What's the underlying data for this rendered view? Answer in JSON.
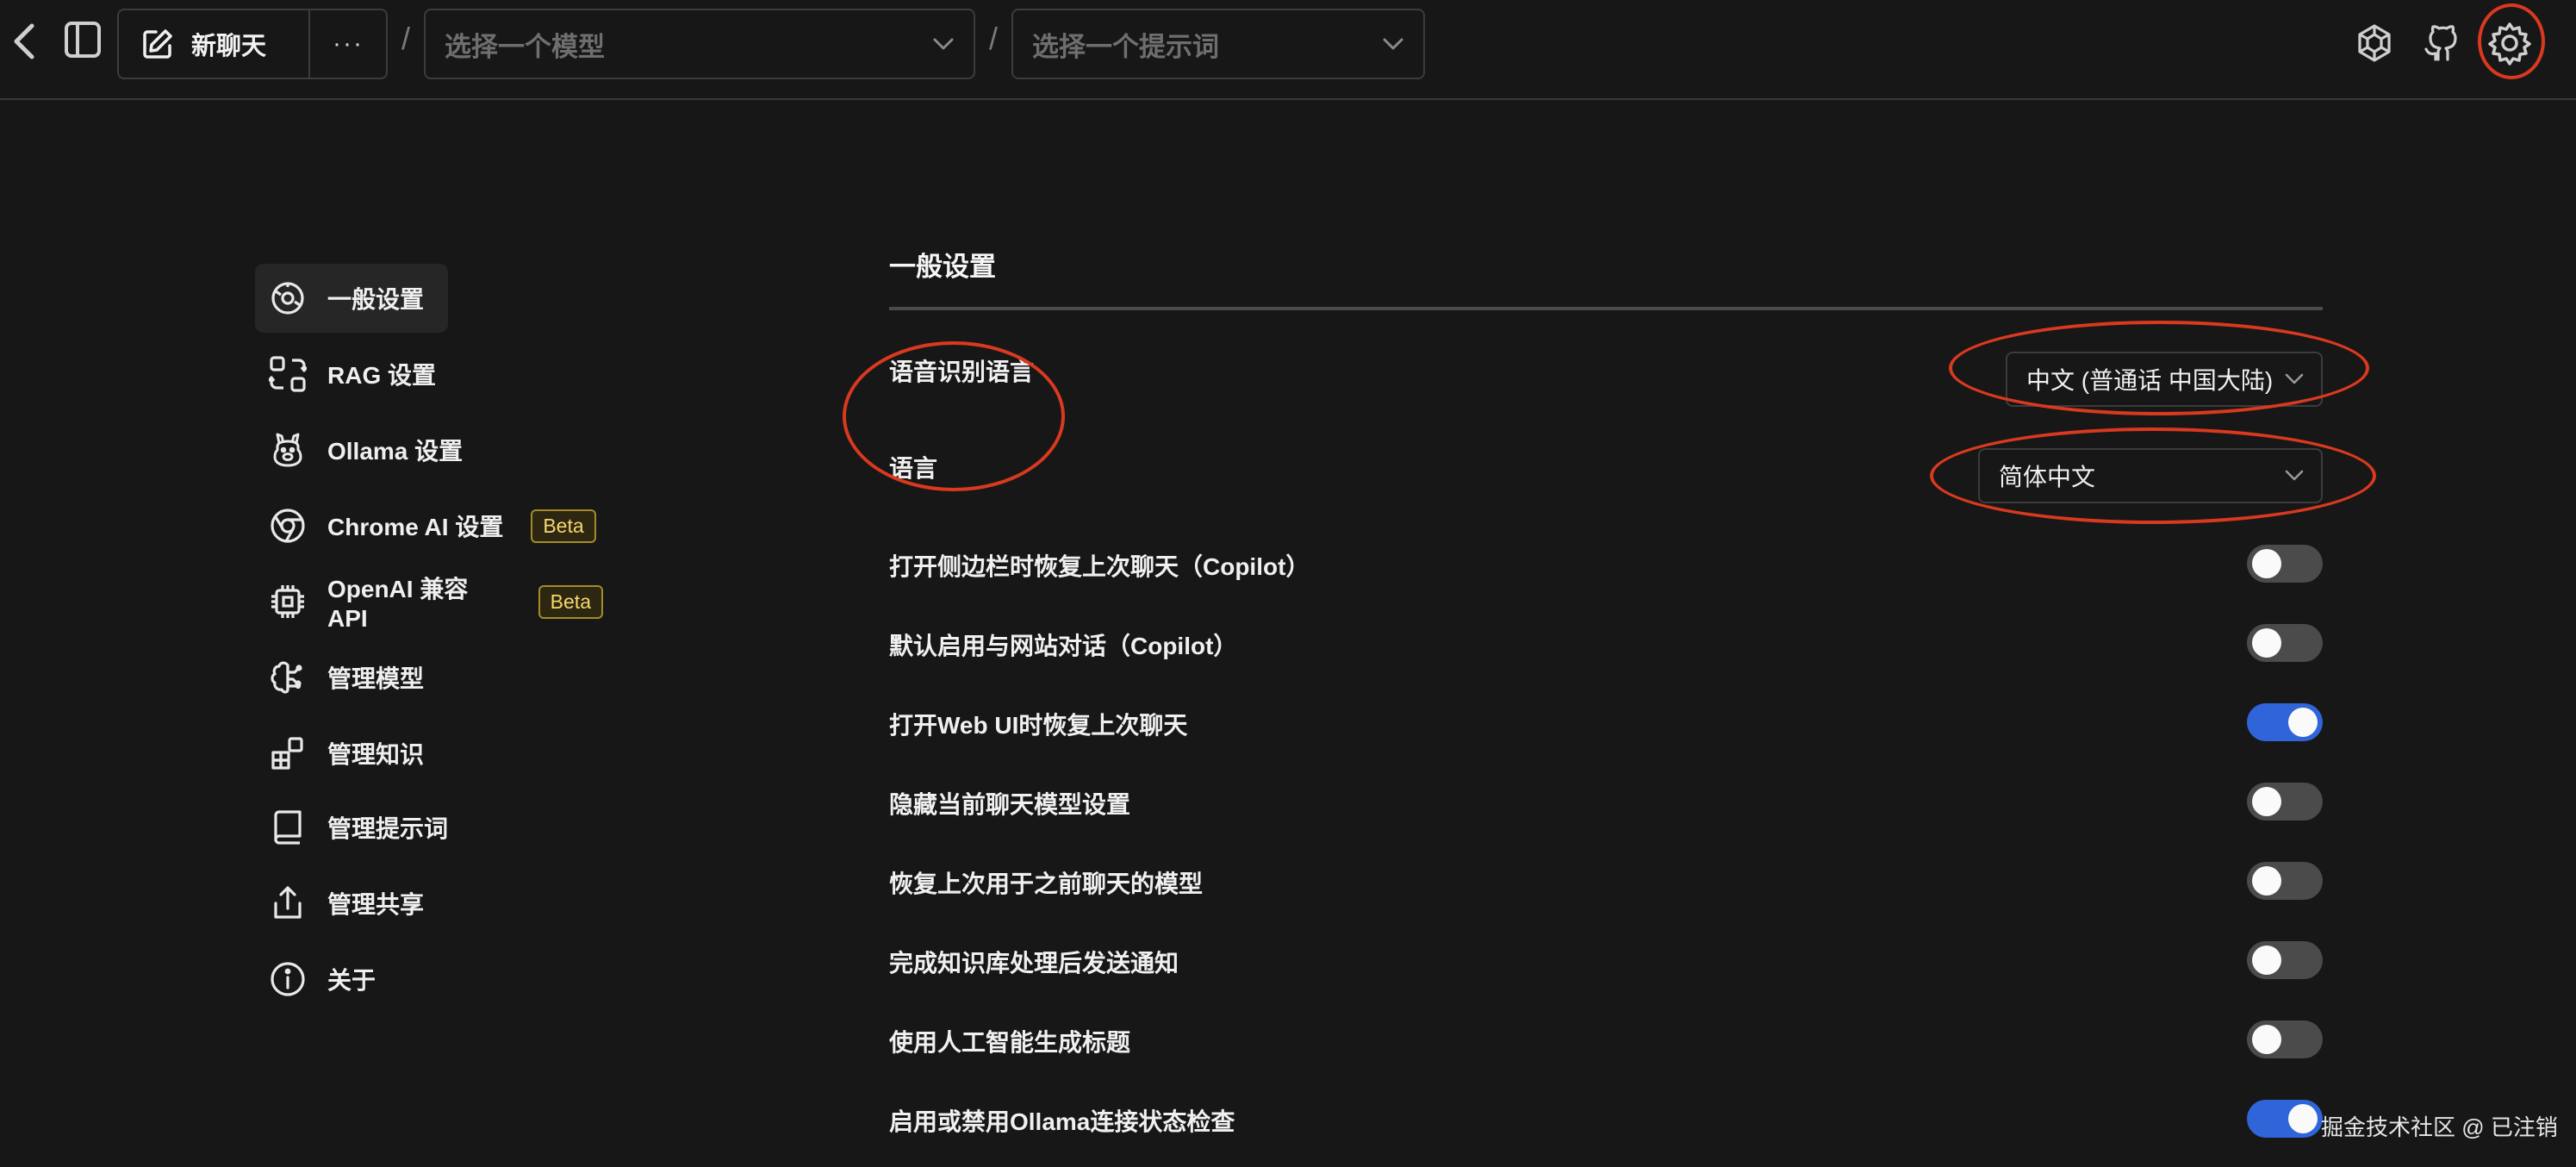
{
  "topbar": {
    "new_chat_label": "新聊天",
    "more_label": "···",
    "separator": "/",
    "model_select_placeholder": "选择一个模型",
    "prompt_select_placeholder": "选择一个提示词"
  },
  "sidebar": {
    "items": [
      {
        "label": "一般设置",
        "icon": "general-settings-icon"
      },
      {
        "label": "RAG 设置",
        "icon": "rag-icon"
      },
      {
        "label": "Ollama 设置",
        "icon": "llama-icon"
      },
      {
        "label": "Chrome AI 设置",
        "icon": "chrome-icon",
        "badge": "Beta"
      },
      {
        "label": "OpenAI 兼容 API",
        "icon": "cpu-icon",
        "badge": "Beta"
      },
      {
        "label": "管理模型",
        "icon": "brain-icon"
      },
      {
        "label": "管理知识",
        "icon": "blocks-icon"
      },
      {
        "label": "管理提示词",
        "icon": "book-icon"
      },
      {
        "label": "管理共享",
        "icon": "share-icon"
      },
      {
        "label": "关于",
        "icon": "info-icon"
      }
    ]
  },
  "main": {
    "section_title": "一般设置",
    "speech_language_label": "语音识别语言",
    "speech_language_value": "中文 (普通话 中国大陆)",
    "language_label": "语言",
    "language_value": "简体中文",
    "toggles": [
      {
        "label": "打开侧边栏时恢复上次聊天（Copilot）",
        "on": false
      },
      {
        "label": "默认启用与网站对话（Copilot）",
        "on": false
      },
      {
        "label": "打开Web UI时恢复上次聊天",
        "on": true
      },
      {
        "label": "隐藏当前聊天模型设置",
        "on": false
      },
      {
        "label": "恢复上次用于之前聊天的模型",
        "on": false
      },
      {
        "label": "完成知识库处理后发送通知",
        "on": false
      },
      {
        "label": "使用人工智能生成标题",
        "on": false
      },
      {
        "label": "启用或禁用Ollama连接状态检查",
        "on": true
      }
    ]
  },
  "watermark": "掘金技术社区 @ 已注销",
  "colors": {
    "background": "#171717",
    "toggle_on": "#2f65d8",
    "toggle_off": "#4b4b4b",
    "annotation": "#d9391f",
    "beta_text": "#f5d86b"
  }
}
